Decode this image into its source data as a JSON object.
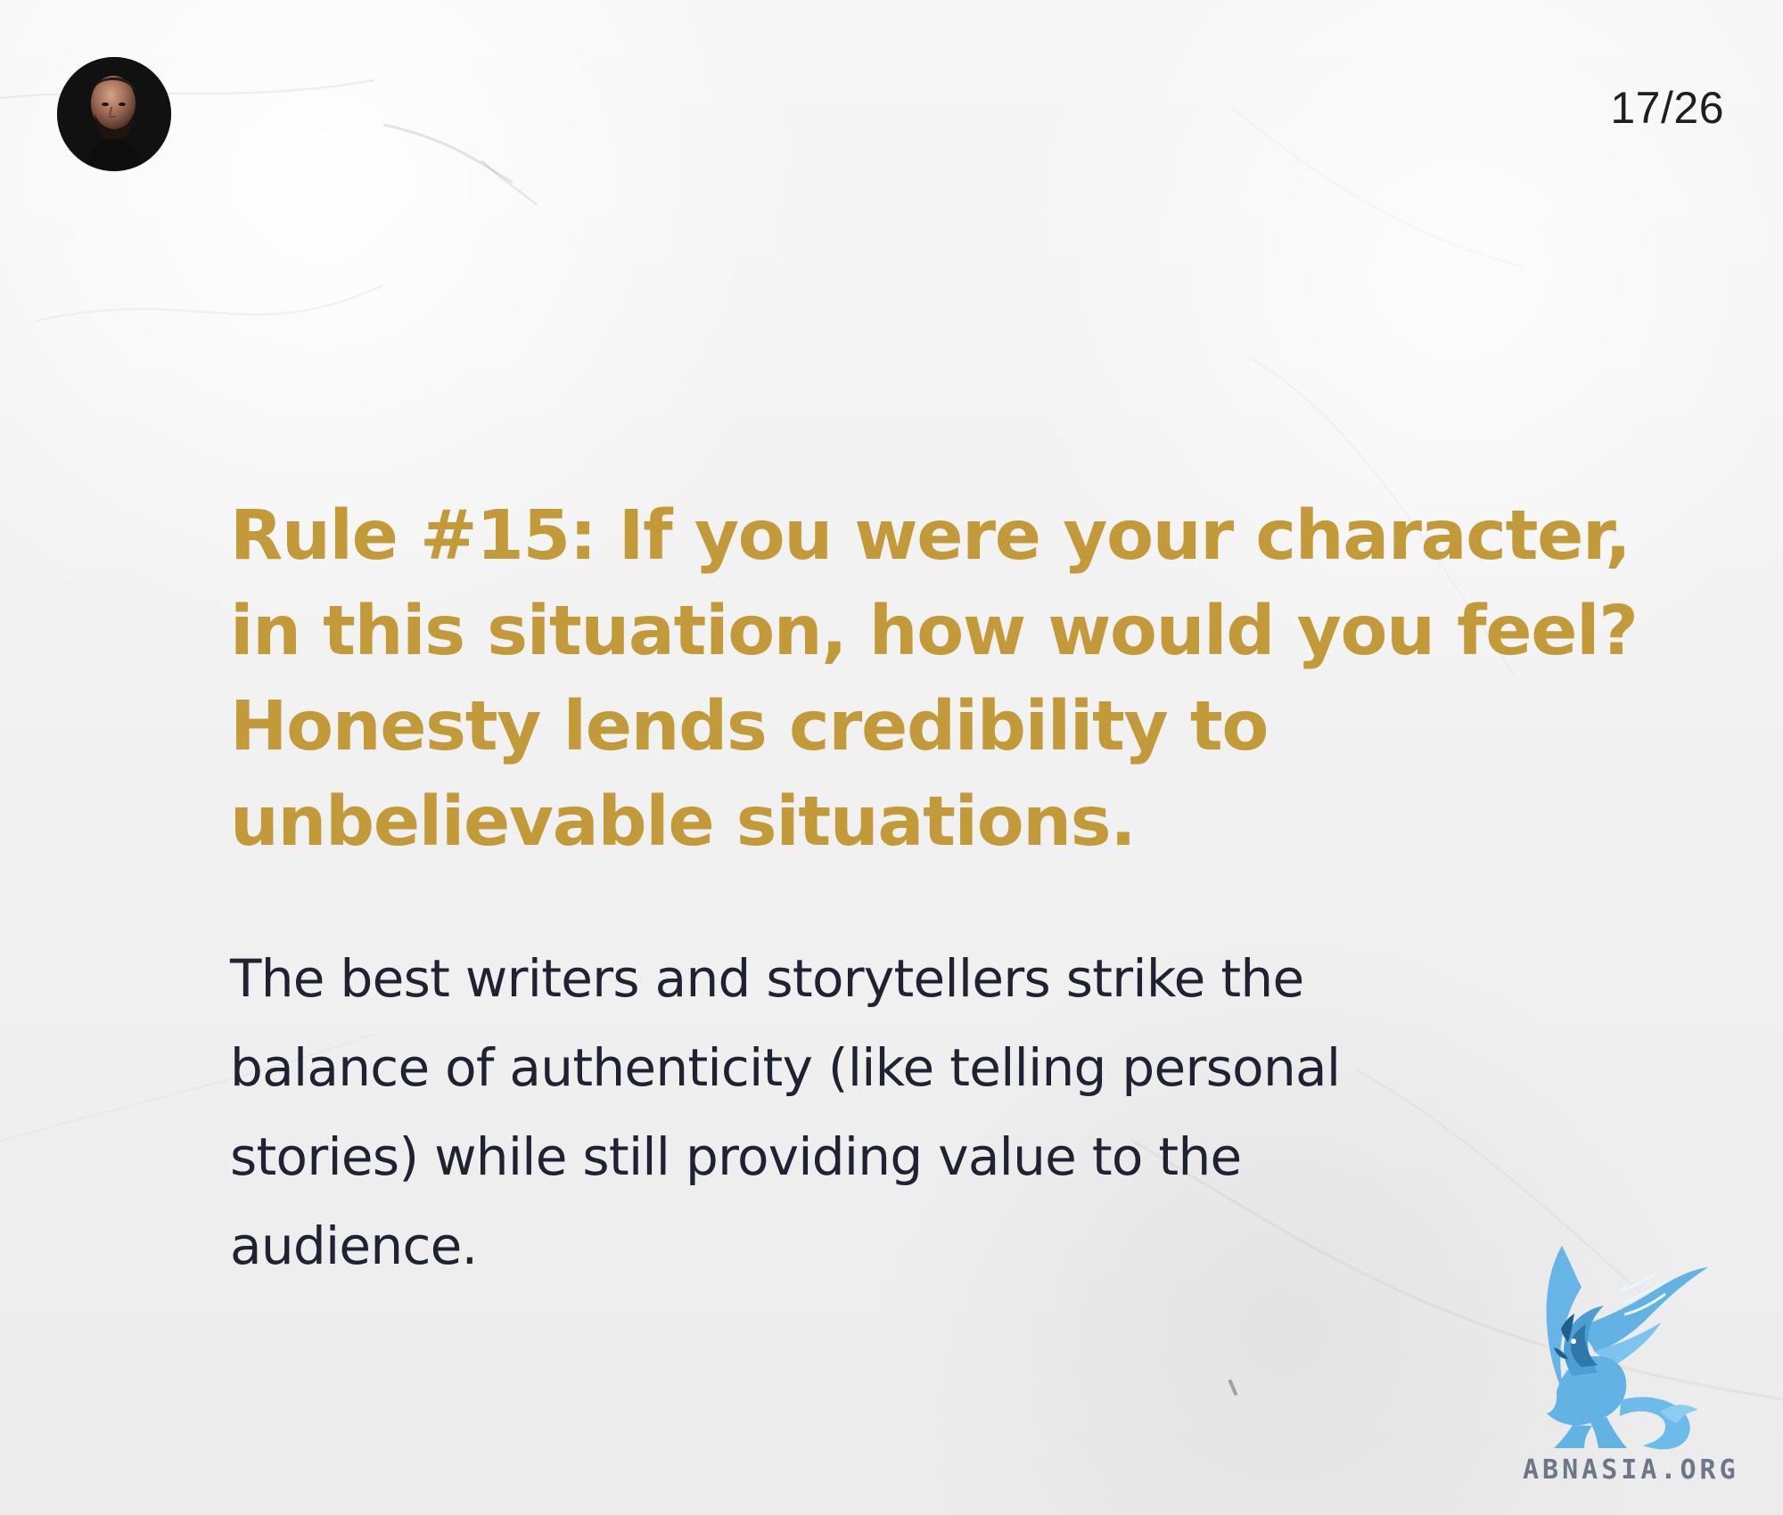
{
  "header": {
    "page_counter": "17/26"
  },
  "content": {
    "headline_lines": [
      "Rule #15: If you were your character,",
      "in this situation, how would you feel?",
      "Honesty lends credibility to",
      "unbelievable situations."
    ],
    "body_lines": [
      "The best writers and storytellers strike the",
      "balance of authenticity (like telling personal",
      "stories) while still providing value to the",
      "audience."
    ]
  },
  "branding": {
    "watermark_text": "ABNASIA.ORG",
    "accent_color": "#c39a3a",
    "body_text_color": "#1f2230",
    "logo_color": "#62b2e3",
    "icons": {
      "avatar": "profile-avatar",
      "logo": "griffin-logo-icon"
    }
  }
}
